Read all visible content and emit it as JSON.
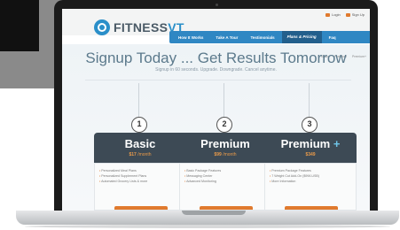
{
  "brand": {
    "prefix": "FITNESS",
    "suffix": "VT"
  },
  "top_links": [
    "Login",
    "Sign Up"
  ],
  "nav": {
    "items": [
      "How It Works",
      "Take A Tour",
      "Testimonials",
      "Plans & Pricing",
      "Faq"
    ],
    "active_index": 3
  },
  "subnav": [
    "Basic",
    "Premium",
    "Premium+"
  ],
  "hero": {
    "headline": "Signup Today ... Get Results Tomorrow",
    "tagline": "Signup in 60 seconds. Upgrade. Downgrade. Cancel anytime."
  },
  "plans": [
    {
      "number": "1",
      "name": "Basic",
      "name_suffix": "",
      "price": "$17",
      "period": "/month",
      "features": [
        "Personalized Meal Plans",
        "Personalized Supplement Plans",
        "Automated Grocery Lists & more"
      ]
    },
    {
      "number": "2",
      "name": "Premium",
      "name_suffix": "",
      "price": "$99",
      "period": "/month",
      "features": [
        "Basic Package Features",
        "Messaging Center",
        "Advanced Monitoring"
      ]
    },
    {
      "number": "3",
      "name": "Premium",
      "name_suffix": "+",
      "price": "$349",
      "period": "",
      "features": [
        "Premium Package Features",
        "7 Weight Cut Add-On ($99/LUSB)",
        "More Information"
      ]
    }
  ],
  "colors": {
    "accent": "#2f87c3",
    "cta": "#e07a2e",
    "card_head": "#3d4a55"
  }
}
